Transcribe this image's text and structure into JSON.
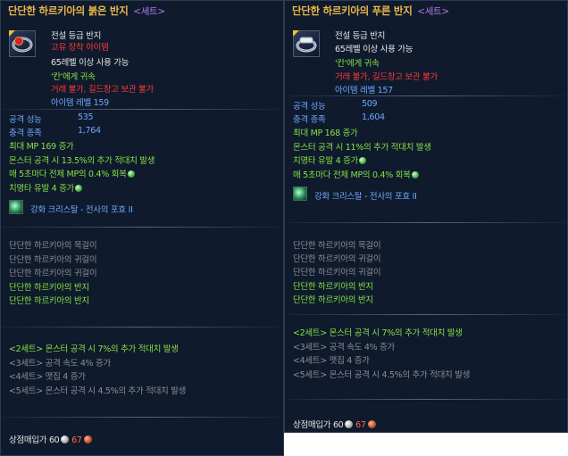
{
  "left": {
    "title": "단단한 하르키아의 붉은 반지",
    "title_tag": "<세트>",
    "grade": "전설 등급 반지",
    "unique": "고유 장착 아이템",
    "level_req": "65레벨 이상 사용 가능",
    "bound": "'칸'에게 귀속",
    "trade": "거래 불가, 길드창고 보관 불가",
    "item_level": "아이템 레벨 159",
    "stats": [
      {
        "label": "공격 성능",
        "value": "535"
      },
      {
        "label": "충격 종족",
        "value": "1,764"
      }
    ],
    "effects": [
      "최대 MP 169 증가",
      "몬스터 공격 시 13.5%의 추가 적대치 발생",
      "매 5초마다 전체 MP의 0.4% 회복",
      "치명타 유발 4 증가"
    ],
    "crystal": "강화 크리스탈 - 전사의 포효 II",
    "set_items": [
      {
        "name": "단단한 하르키아의 목걸이",
        "owned": false
      },
      {
        "name": "단단한 하르키아의 귀걸이",
        "owned": false
      },
      {
        "name": "단단한 하르키아의 귀걸이",
        "owned": false
      },
      {
        "name": "단단한 하르키아의 반지",
        "owned": true
      },
      {
        "name": "단단한 하르키아의 반지",
        "owned": true
      }
    ],
    "set_bonuses": [
      {
        "text": "<2세트> 몬스터 공격 시 7%의 추가 적대치 발생",
        "active": true
      },
      {
        "text": "<3세트> 공격 속도 4% 증가",
        "active": false
      },
      {
        "text": "<4세트> 맷집 4 증가",
        "active": false
      },
      {
        "text": "<5세트> 몬스터 공격 시 4.5%의 추가 적대치 발생",
        "active": false
      }
    ],
    "price_label": "상점매입가",
    "price_silver": "60",
    "price_copper": "67"
  },
  "right": {
    "title": "단단한 하르키아의 푸른 반지",
    "title_tag": "<세트>",
    "grade": "전설 등급 반지",
    "level_req": "65레벨 이상 사용 가능",
    "bound": "'칸'에게 귀속",
    "trade": "거래 불가, 길드창고 보관 불가",
    "item_level": "아이템 레벨 157",
    "stats": [
      {
        "label": "공격 성능",
        "value": "509"
      },
      {
        "label": "충격 종족",
        "value": "1,604"
      }
    ],
    "effects": [
      "최대 MP 168 증가",
      "몬스터 공격 시 11%의 추가 적대치 발생",
      "치명타 유발 4 증가",
      "매 5초마다 전체 MP의 0.4% 회복"
    ],
    "crystal": "강화 크리스탈 - 전사의 포효 II",
    "set_items": [
      {
        "name": "단단한 하르키아의 목걸이",
        "owned": false
      },
      {
        "name": "단단한 하르키아의 귀걸이",
        "owned": false
      },
      {
        "name": "단단한 하르키아의 귀걸이",
        "owned": false
      },
      {
        "name": "단단한 하르키아의 반지",
        "owned": true
      },
      {
        "name": "단단한 하르키아의 반지",
        "owned": true
      }
    ],
    "set_bonuses": [
      {
        "text": "<2세트> 몬스터 공격 시 7%의 추가 적대치 발생",
        "active": true
      },
      {
        "text": "<3세트> 공격 속도 4% 증가",
        "active": false
      },
      {
        "text": "<4세트> 맷집 4 증가",
        "active": false
      },
      {
        "text": "<5세트> 몬스터 공격 시 4.5%의 추가 적대치 발생",
        "active": false
      }
    ],
    "price_label": "상점매입가",
    "price_silver": "60",
    "price_copper": "67"
  }
}
